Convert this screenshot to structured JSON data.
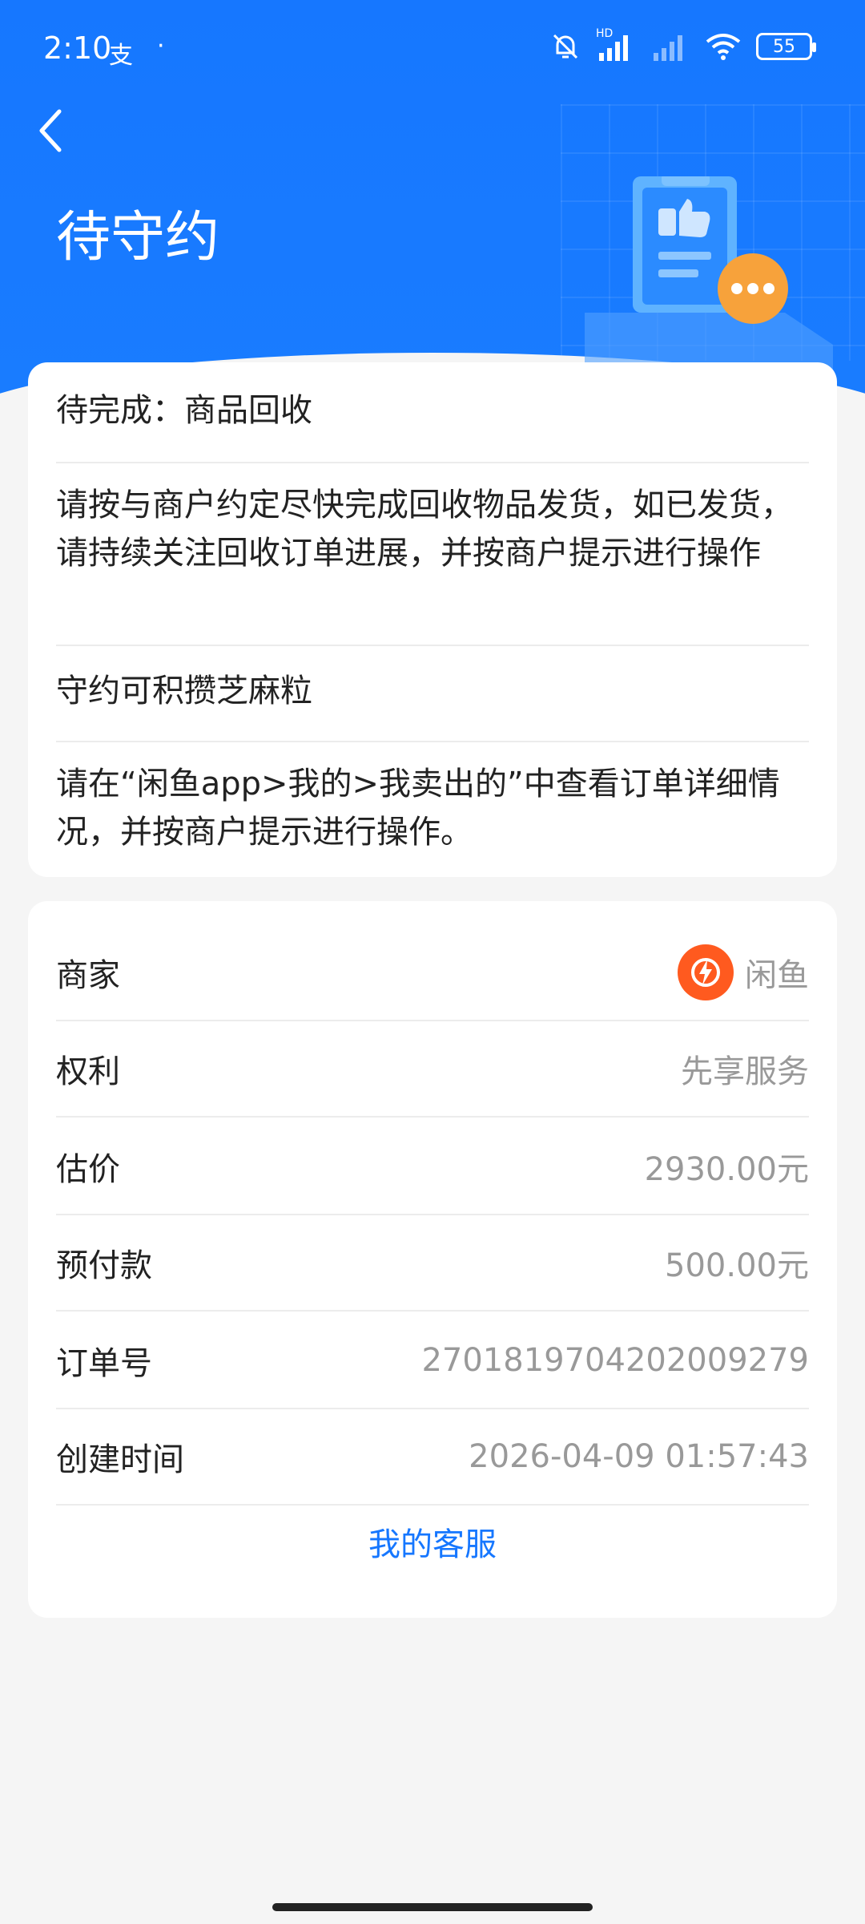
{
  "status_bar": {
    "time": "2:10",
    "app_indicator": "支",
    "dot": "·",
    "network_label": "HD",
    "battery": "55"
  },
  "header": {
    "title": "待守约"
  },
  "notice_card": {
    "pending": "待完成：商品回收",
    "instruction": "请按与商户约定尽快完成回收物品发货，如已发货，请持续关注回收订单进展，并按商户提示进行操作",
    "reward": "守约可积攒芝麻粒",
    "guide": "请在“闲鱼app>我的>我卖出的”中查看订单详细情况，并按商户提示进行操作。"
  },
  "order_card": {
    "rows": [
      {
        "label": "商家",
        "value": "闲鱼"
      },
      {
        "label": "权利",
        "value": "先享服务"
      },
      {
        "label": "估价",
        "value": "2930.00元"
      },
      {
        "label": "预付款",
        "value": "500.00元"
      },
      {
        "label": "订单号",
        "value": "2701819704202009279"
      },
      {
        "label": "创建时间",
        "value": "2026-04-09 01:57:43"
      }
    ],
    "service_link": "我的客服"
  },
  "colors": {
    "brand_blue": "#1677ff",
    "merchant_orange": "#ff5a1f",
    "badge_orange": "#f7a23b"
  },
  "icons": [
    "back-arrow-icon",
    "mute-bell-icon",
    "signal-icon",
    "wifi-icon",
    "battery-icon",
    "xianyu-logo-icon",
    "thumbs-up-document-icon",
    "more-dots-icon"
  ]
}
